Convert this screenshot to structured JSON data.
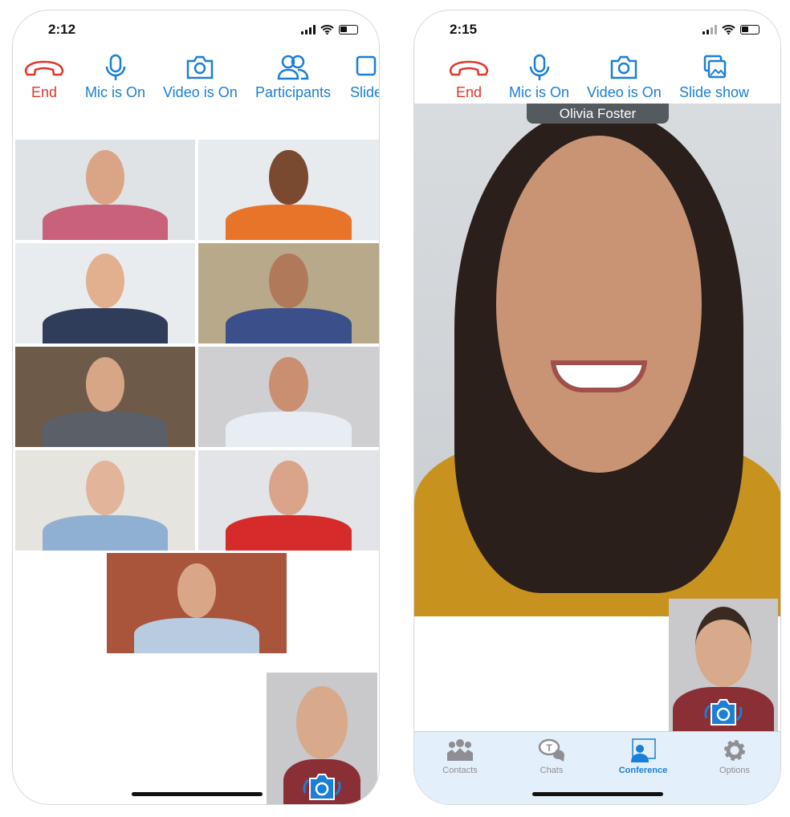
{
  "left_screen": {
    "status": {
      "time": "2:12"
    },
    "toolbar": {
      "end": "End",
      "mic": "Mic is On",
      "video": "Video is On",
      "participants": "Participants",
      "slide": "Slide"
    }
  },
  "right_screen": {
    "status": {
      "time": "2:15"
    },
    "toolbar": {
      "end": "End",
      "mic": "Mic is On",
      "video": "Video is On",
      "slide": "Slide show"
    },
    "speaker_name": "Olivia Foster",
    "tabs": [
      {
        "label": "Contacts",
        "icon": "contacts-icon"
      },
      {
        "label": "Chats",
        "icon": "chats-icon"
      },
      {
        "label": "Conference",
        "icon": "conference-icon",
        "active": true
      },
      {
        "label": "Options",
        "icon": "gear-icon"
      }
    ]
  },
  "colors": {
    "accent": "#1a7fd6",
    "end": "#e0352b",
    "tabbar": "#e3f0fb"
  }
}
